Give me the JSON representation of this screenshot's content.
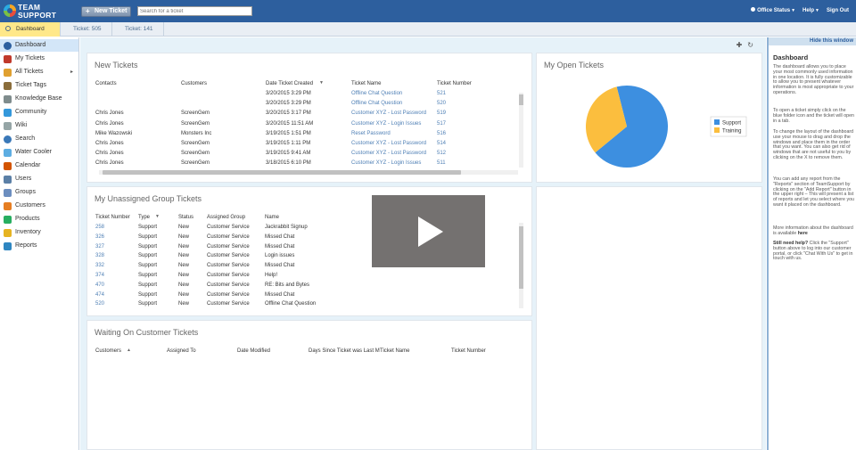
{
  "topbar": {
    "logo_line1": "TEAM",
    "logo_line2": "SUPPORT",
    "new_ticket": "New Ticket",
    "search_placeholder": "Search for a ticket",
    "office_status": "Office Status",
    "help": "Help",
    "sign_out": "Sign Out"
  },
  "tabs": [
    {
      "label": "Dashboard"
    },
    {
      "label": "Ticket: 505"
    },
    {
      "label": "Ticket: 141"
    }
  ],
  "sidebar": {
    "items": [
      {
        "label": "Dashboard",
        "icon": "dashboard-icon",
        "color": "#2d5f9e"
      },
      {
        "label": "My Tickets",
        "icon": "my-tickets-icon",
        "color": "#c0392b"
      },
      {
        "label": "All Tickets",
        "icon": "all-tickets-icon",
        "color": "#e0a030"
      },
      {
        "label": "Ticket Tags",
        "icon": "tag-icon",
        "color": "#8a6d3b"
      },
      {
        "label": "Knowledge Base",
        "icon": "knowledge-base-icon",
        "color": "#7f8c8d"
      },
      {
        "label": "Community",
        "icon": "community-icon",
        "color": "#3498db"
      },
      {
        "label": "Wiki",
        "icon": "wiki-icon",
        "color": "#95a5a6"
      },
      {
        "label": "Search",
        "icon": "search-icon",
        "color": "#3a78b8"
      },
      {
        "label": "Water Cooler",
        "icon": "water-cooler-icon",
        "color": "#5dade2"
      },
      {
        "label": "Calendar",
        "icon": "calendar-icon",
        "color": "#d35400"
      },
      {
        "label": "Users",
        "icon": "users-icon",
        "color": "#5b7fa6"
      },
      {
        "label": "Groups",
        "icon": "groups-icon",
        "color": "#6c8ebf"
      },
      {
        "label": "Customers",
        "icon": "customers-icon",
        "color": "#e67e22"
      },
      {
        "label": "Products",
        "icon": "products-icon",
        "color": "#27ae60"
      },
      {
        "label": "Inventory",
        "icon": "inventory-icon",
        "color": "#e6b422"
      },
      {
        "label": "Reports",
        "icon": "reports-icon",
        "color": "#2e86c1"
      }
    ]
  },
  "new_tickets": {
    "title": "New Tickets",
    "headers": [
      "Contacts",
      "Customers",
      "Date Ticket Created",
      "Ticket Name",
      "Ticket Number"
    ],
    "rows": [
      [
        "",
        "",
        "3/20/2015 3:29 PM",
        "Offline Chat Question",
        "521"
      ],
      [
        "",
        "",
        "3/20/2015 3:29 PM",
        "Offline Chat Question",
        "520"
      ],
      [
        "Chris Jones",
        "ScreenGem",
        "3/20/2015 3:17 PM",
        "Customer XYZ - Lost Password",
        "519"
      ],
      [
        "Chris Jones",
        "ScreenGem",
        "3/20/2015 11:51 AM",
        "Customer XYZ - Login Issues",
        "517"
      ],
      [
        "Mike Wazowski",
        "Monsters Inc",
        "3/19/2015 1:51 PM",
        "Reset Password",
        "516"
      ],
      [
        "Chris Jones",
        "ScreenGem",
        "3/19/2015 1:11 PM",
        "Customer XYZ - Lost Password",
        "514"
      ],
      [
        "Chris Jones",
        "ScreenGem",
        "3/19/2015 9:41 AM",
        "Customer XYZ - Lost Password",
        "512"
      ],
      [
        "Chris Jones",
        "ScreenGem",
        "3/18/2015 6:10 PM",
        "Customer XYZ - Login Issues",
        "511"
      ]
    ]
  },
  "open_tickets": {
    "title": "My Open Tickets",
    "chart_data": {
      "type": "pie",
      "categories": [
        "Support",
        "Training"
      ],
      "values": [
        0.68,
        0.32
      ],
      "colors": [
        "#3d8fe0",
        "#fbbe3e"
      ],
      "legend_position": "right"
    }
  },
  "unassigned": {
    "title": "My Unassigned Group Tickets",
    "headers": [
      "Ticket Number",
      "Type",
      "Status",
      "Assigned Group",
      "Name"
    ],
    "rows": [
      [
        "258",
        "Support",
        "New",
        "Customer Service",
        "Jackrabbit Signup"
      ],
      [
        "326",
        "Support",
        "New",
        "Customer Service",
        "Missed Chat"
      ],
      [
        "327",
        "Support",
        "New",
        "Customer Service",
        "Missed Chat"
      ],
      [
        "328",
        "Support",
        "New",
        "Customer Service",
        "Login issues"
      ],
      [
        "332",
        "Support",
        "New",
        "Customer Service",
        "Missed Chat"
      ],
      [
        "374",
        "Support",
        "New",
        "Customer Service",
        "Help!"
      ],
      [
        "470",
        "Support",
        "New",
        "Customer Service",
        "RE: Bits and Bytes"
      ],
      [
        "474",
        "Support",
        "New",
        "Customer Service",
        "Missed Chat"
      ],
      [
        "520",
        "Support",
        "New",
        "Customer Service",
        "Offline Chat Question"
      ]
    ]
  },
  "waiting": {
    "title": "Waiting On Customer Tickets",
    "headers": [
      "Customers",
      "Assigned To",
      "Date Modified",
      "Days Since Ticket was Last M",
      "Ticket Name",
      "Ticket Number"
    ]
  },
  "help": {
    "hide": "Hide this window",
    "title": "Dashboard",
    "p1": "The dashboard allows you to place your most commonly used information in one location. It is fully customizable to allow you to present whatever information is most appropriate to your operations.",
    "p2": "To open a ticket simply click on the blue folder icon and the ticket will open in a tab.",
    "p3": "To change the layout of the dashboard use your mouse to drag and drop the windows and place them in the order that you want. You can also get rid of windows that are not useful to you by clicking on the X to remove them.",
    "p4": "You can add any report from the \"Reports\" section of TeamSupport by clicking on the \"Add Report\" button in the upper right – This will present a list of reports and let you select where you want it placed on the dashboard.",
    "p5_pre": "More information about the dashboard is available ",
    "p5_link": "here",
    "p6_bold": "Still need help?",
    "p6": " Click the \"Support\" button above to log into our customer portal, or click \"Chat With Us\" to get in touch with us."
  }
}
